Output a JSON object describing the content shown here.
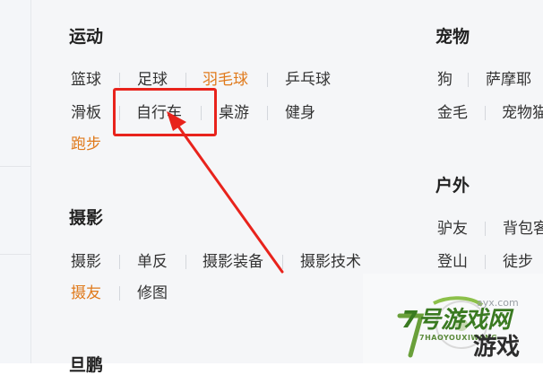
{
  "colors": {
    "highlight": "#e8231c",
    "accent_tag": "#e07a1c",
    "text": "#333333",
    "watermark_green": "#3a7a21"
  },
  "sections": {
    "sports": {
      "title": "运动",
      "tags": [
        "篮球",
        "足球",
        "羽毛球",
        "乒乓球",
        "滑板",
        "自行车",
        "桌游",
        "健身",
        "跑步"
      ]
    },
    "photo": {
      "title": "摄影",
      "tags": [
        "摄影",
        "单反",
        "摄影装备",
        "摄影技术",
        "摄友",
        "修图"
      ]
    },
    "pets": {
      "title": "宠物",
      "tags": [
        "狗",
        "萨摩耶",
        "金毛",
        "宠物猫"
      ]
    },
    "outdoor": {
      "title": "户外",
      "tags": [
        "驴友",
        "背包客",
        "登山",
        "徒步"
      ]
    },
    "next_section_partial": "旦鹏"
  },
  "watermark": {
    "brand": "7号游戏网",
    "sub": "7HAOYOUXIWANG",
    "game": "游戏",
    "domain": "ayx.com",
    "icon_name": "watermark-logo-icon"
  },
  "annotation": {
    "icon_name": "red-arrow-icon"
  }
}
